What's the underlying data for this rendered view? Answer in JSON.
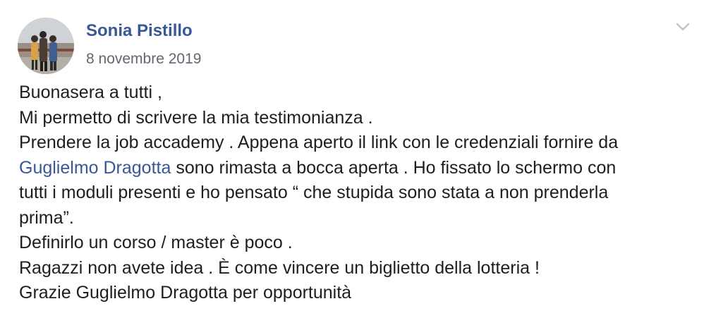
{
  "post": {
    "author": "Sonia Pistillo",
    "date": "8 novembre 2019",
    "menu_icon": "chevron-down-icon",
    "avatar_icon": "profile-photo",
    "text": {
      "line1": "Buonasera a tutti ,",
      "line2": "Mi permetto di scrivere la mia testimonianza .",
      "line3": "Prendere la job accademy . Appena aperto il link con le credenziali fornire da",
      "mention": "Guglielmo Dragotta",
      "line4_rest": " sono rimasta a bocca aperta . Ho fissato lo schermo con",
      "line5": "tutti i moduli presenti e ho pensato “ che stupida sono stata a non prenderla",
      "line6": "prima”.",
      "line7": "Definirlo un corso / master è poco .",
      "line8": "Ragazzi non avete idea . È come vincere un biglietto della lotteria !",
      "line9": "Grazie Guglielmo Dragotta per opportunità"
    }
  },
  "colors": {
    "link": "#385898",
    "text": "#1c1e21",
    "meta": "#616770",
    "background": "#ffffff"
  }
}
